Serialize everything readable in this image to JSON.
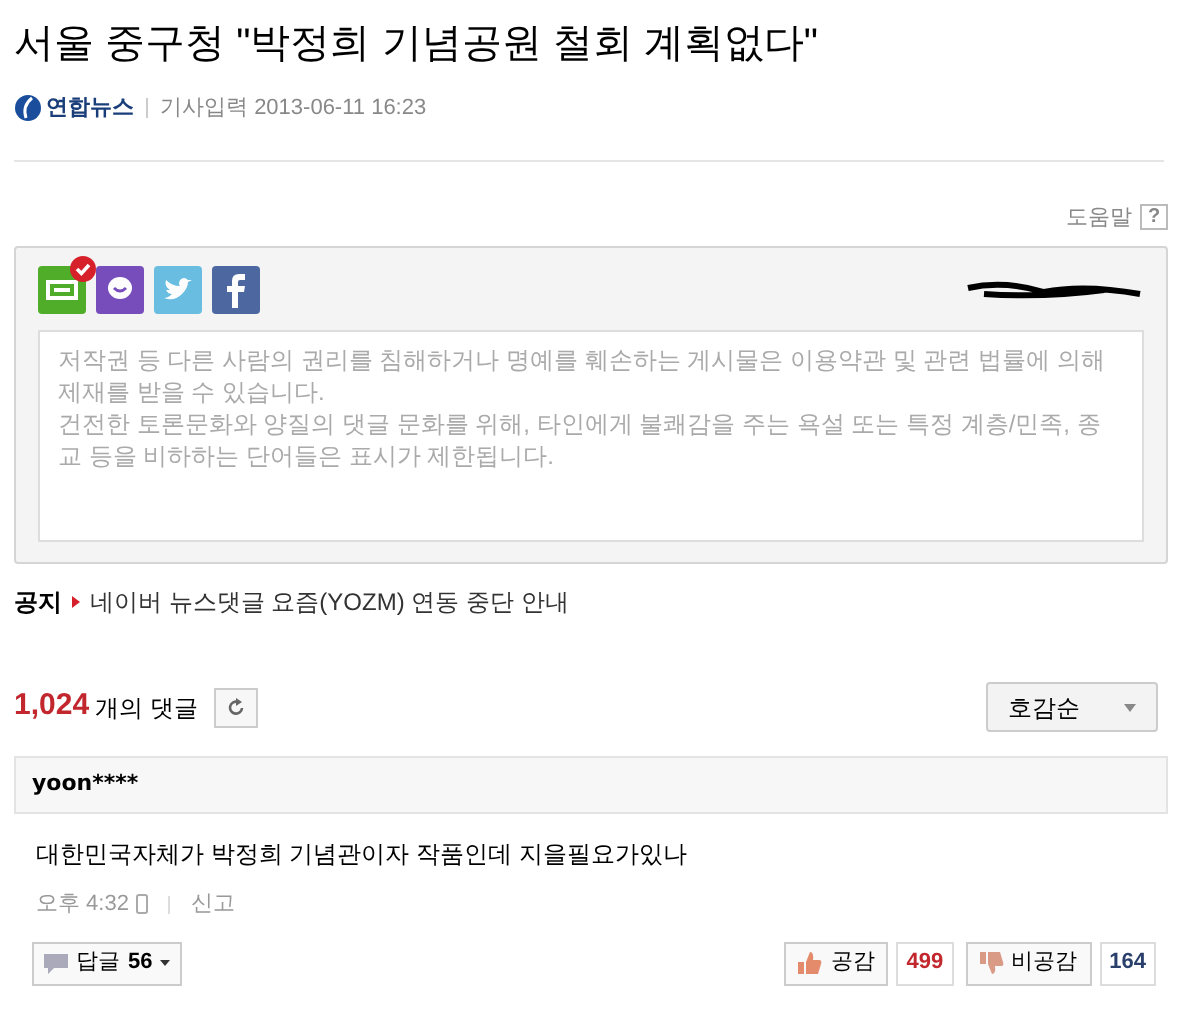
{
  "article": {
    "title": "서울 중구청 \"박정희 기념공원 철회 계획없다\"",
    "source": "연합뉴스",
    "date_label": "기사입력",
    "date": "2013-06-11 16:23"
  },
  "help": {
    "label": "도움말",
    "icon_text": "?"
  },
  "share": [
    {
      "kind": "naver",
      "selected": true
    },
    {
      "kind": "yozm",
      "selected": false
    },
    {
      "kind": "twitter",
      "selected": false
    },
    {
      "kind": "facebook",
      "selected": false
    }
  ],
  "comment_field": {
    "placeholder": [
      "저작권 등 다른 사람의 권리를 침해하거나 명예를 훼손하는 게시물은 이용약관 및 관련 법률에 의해 제재를 받을 수 있습니다.",
      "건전한 토론문화와 양질의 댓글 문화를 위해, 타인에게 불쾌감을 주는 욕설 또는 특정 계층/민족, 종교 등을 비하하는 단어들은 표시가 제한됩니다."
    ]
  },
  "notice": {
    "label": "공지",
    "text": "네이버 뉴스댓글 요즘(YOZM) 연동 중단 안내"
  },
  "comments_count": {
    "count": "1,024",
    "suffix": "개의 댓글"
  },
  "sort": {
    "value": "호감순"
  },
  "comment": {
    "author": "yoon****",
    "text": "대한민국자체가 박정희 기념관이자 작품인데 지을필요가있나",
    "time": "오후 4:32",
    "report": "신고",
    "reply_label": "답글",
    "reply_count": "56",
    "like_label": "공감",
    "likes": "499",
    "dislike_label": "비공감",
    "dislikes": "164"
  }
}
